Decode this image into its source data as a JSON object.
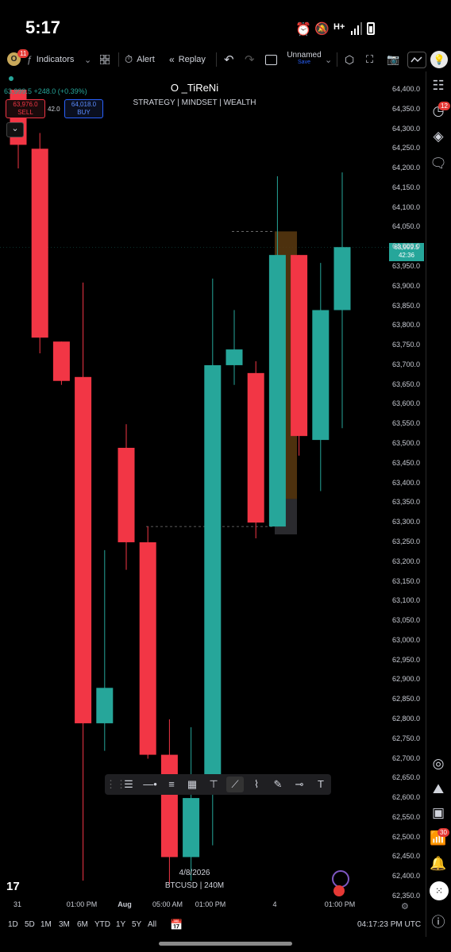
{
  "status_bar": {
    "time": "5:17"
  },
  "toolbar": {
    "avatar_letter": "O",
    "avatar_badge": "11",
    "indicators_label": "Indicators",
    "alert_label": "Alert",
    "replay_label": "Replay",
    "layout_name": "Unnamed",
    "layout_sub": "Save"
  },
  "legend": {
    "price_line": "63,999.5 +248.0 (+0.39%)",
    "sell_price": "63,976.0",
    "sell_label": "SELL",
    "spread": "42.0",
    "buy_price": "64,018.0",
    "buy_label": "BUY"
  },
  "watermark": {
    "title": "O _TiReNi",
    "subtitle": "STRATEGY  |  MINDSET |  WEALTH"
  },
  "current_price": {
    "value": "63,999.5",
    "countdown": "42:36",
    "color": "#26a69a"
  },
  "chart_info": {
    "date": "4/8/2026",
    "symbol": "BTCUSD | 240M"
  },
  "right_panel": {
    "alerts_badge": "12",
    "notifications_badge": "30"
  },
  "bottom_bar": {
    "ranges": [
      "1D",
      "5D",
      "1M",
      "3M",
      "6M",
      "YTD",
      "1Y",
      "5Y",
      "All"
    ],
    "clock": "04:17:23 PM UTC"
  },
  "colors": {
    "up": "#26a69a",
    "down": "#f23645",
    "background": "#000000"
  },
  "chart_data": {
    "type": "candlestick",
    "y_ticks": [
      "64,400.0",
      "64,350.0",
      "64,300.0",
      "64,250.0",
      "64,200.0",
      "64,150.0",
      "64,100.0",
      "64,050.0",
      "64,000.0",
      "63,950.0",
      "63,900.0",
      "63,850.0",
      "63,800.0",
      "63,750.0",
      "63,700.0",
      "63,650.0",
      "63,600.0",
      "63,550.0",
      "63,500.0",
      "63,450.0",
      "63,400.0",
      "63,350.0",
      "63,300.0",
      "63,250.0",
      "63,200.0",
      "63,150.0",
      "63,100.0",
      "63,050.0",
      "63,000.0",
      "62,950.0",
      "62,900.0",
      "62,850.0",
      "62,800.0",
      "62,750.0",
      "62,700.0",
      "62,650.0",
      "62,600.0",
      "62,550.0",
      "62,500.0",
      "62,450.0",
      "62,400.0",
      "62,350.0"
    ],
    "x_ticks": [
      {
        "label": "31",
        "x": 22
      },
      {
        "label": "01:00 PM",
        "x": 103
      },
      {
        "label": "Aug",
        "x": 157
      },
      {
        "label": "05:00 AM",
        "x": 211
      },
      {
        "label": "01:00 PM",
        "x": 265
      },
      {
        "label": "4",
        "x": 346
      },
      {
        "label": "01:00 PM",
        "x": 428
      }
    ],
    "ylim": [
      62350,
      64400
    ],
    "candles": [
      {
        "o": 64400,
        "h": 64400,
        "l": 64200,
        "c": 64260
      },
      {
        "o": 64250,
        "h": 64290,
        "l": 63730,
        "c": 63770
      },
      {
        "o": 63760,
        "h": 63760,
        "l": 63650,
        "c": 63660
      },
      {
        "o": 63670,
        "h": 63910,
        "l": 62390,
        "c": 62790
      },
      {
        "o": 62790,
        "h": 63230,
        "l": 62720,
        "c": 62880
      },
      {
        "o": 63490,
        "h": 63550,
        "l": 63180,
        "c": 63250
      },
      {
        "o": 63250,
        "h": 63290,
        "l": 62700,
        "c": 62710
      },
      {
        "o": 62710,
        "h": 62800,
        "l": 62380,
        "c": 62450
      },
      {
        "o": 62450,
        "h": 62780,
        "l": 62390,
        "c": 62600
      },
      {
        "o": 62650,
        "h": 63920,
        "l": 62480,
        "c": 63700
      },
      {
        "o": 63700,
        "h": 63840,
        "l": 63650,
        "c": 63740
      },
      {
        "o": 63680,
        "h": 63710,
        "l": 63260,
        "c": 63300
      },
      {
        "o": 63290,
        "h": 64180,
        "l": 63290,
        "c": 63980
      },
      {
        "o": 63980,
        "h": 63980,
        "l": 63470,
        "c": 63520
      },
      {
        "o": 63510,
        "h": 63960,
        "l": 63380,
        "c": 63840
      },
      {
        "o": 63840,
        "h": 64190,
        "l": 63540,
        "c": 64000
      }
    ]
  }
}
